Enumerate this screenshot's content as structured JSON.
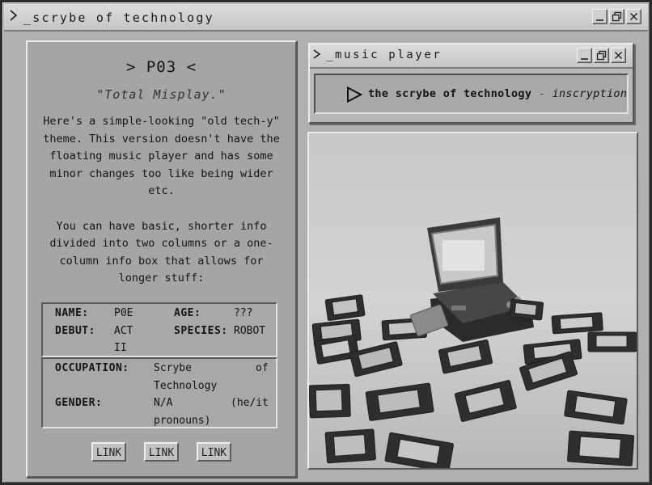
{
  "window": {
    "title": ">_scrybe of technology",
    "title_text": "_scrybe of technology"
  },
  "profile": {
    "code": "> P03 <",
    "quote": "\"Total Misplay.\"",
    "description": [
      "Here's a simple-looking \"old tech-y\" theme. This version doesn't have the floating music player and has some minor changes too like being wider etc.",
      "You can have basic, shorter info divided into two columns or a one-column info box that allows for longer stuff:"
    ],
    "info_two_col": {
      "name_label": "NAME:",
      "name_value": "P0E",
      "age_label": "AGE:",
      "age_value": "???",
      "debut_label": "DEBUT:",
      "debut_value_line1": "ACT",
      "debut_value_line2": "II",
      "species_label": "SPECIES:",
      "species_value": "ROBOT"
    },
    "info_one_col": {
      "occupation_label": "OCCUPATION:",
      "occupation_value_line1_a": "Scrybe",
      "occupation_value_line1_b": "of",
      "occupation_value_line2": "Technology",
      "gender_label": "GENDER:",
      "gender_value_line1_a": "N/A",
      "gender_value_line1_b": "(he/it",
      "gender_value_line2": "pronouns)"
    },
    "links": [
      "LINK",
      "LINK",
      "LINK"
    ]
  },
  "music_player": {
    "title": "_music player",
    "track_title": "the scrybe of technology",
    "separator": " - ",
    "track_artist": "inscryption"
  },
  "photo": {
    "subject": "handheld-console-and-game-cartridges"
  },
  "colors": {
    "background": "#2b2b2b",
    "window": "#b0b0b0",
    "panel": "#a5a5a5",
    "text": "#1c1c1c"
  }
}
